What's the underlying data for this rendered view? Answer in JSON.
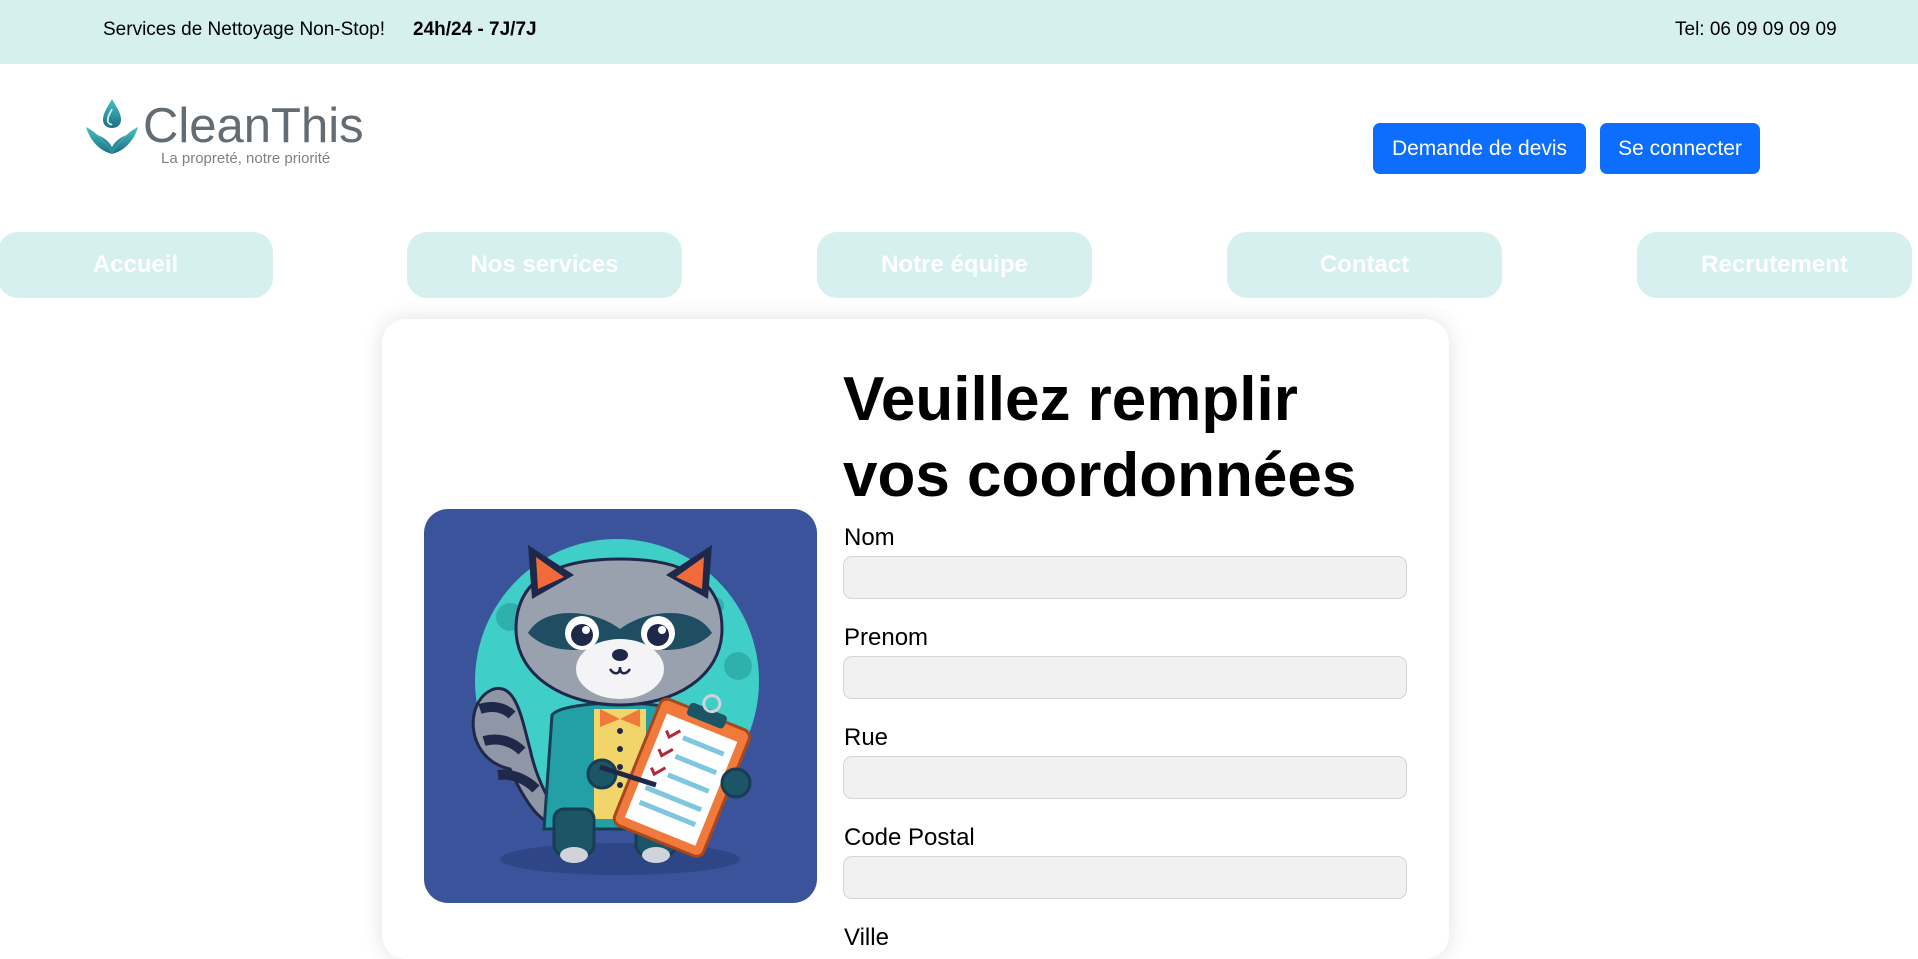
{
  "topbar": {
    "tagline": "Services de Nettoyage Non-Stop!",
    "hours": "24h/24 - 7J/7J",
    "phone": "Tel: 06 09 09 09 09"
  },
  "brand": {
    "name": "CleanThis",
    "slogan": "La propreté, notre priorité",
    "icon": "water-drop-leaves-icon",
    "colors": {
      "accent": "#2aa3a8",
      "text": "#646c73"
    }
  },
  "header": {
    "quote_button": "Demande de devis",
    "login_button": "Se connecter",
    "button_color": "#0d6efd"
  },
  "nav": {
    "items": [
      {
        "label": "Accueil"
      },
      {
        "label": "Nos services"
      },
      {
        "label": "Notre équipe"
      },
      {
        "label": "Contact"
      },
      {
        "label": "Recrutement"
      }
    ],
    "background": "#d6efef"
  },
  "form": {
    "title": "Veuillez remplir vos coordonnées",
    "illustration": "raccoon-with-clipboard-icon",
    "fields": [
      {
        "label": "Nom",
        "value": "",
        "placeholder": ""
      },
      {
        "label": "Prenom",
        "value": "",
        "placeholder": ""
      },
      {
        "label": "Rue",
        "value": "",
        "placeholder": ""
      },
      {
        "label": "Code Postal",
        "value": "",
        "placeholder": ""
      },
      {
        "label": "Ville",
        "value": "",
        "placeholder": ""
      }
    ]
  }
}
